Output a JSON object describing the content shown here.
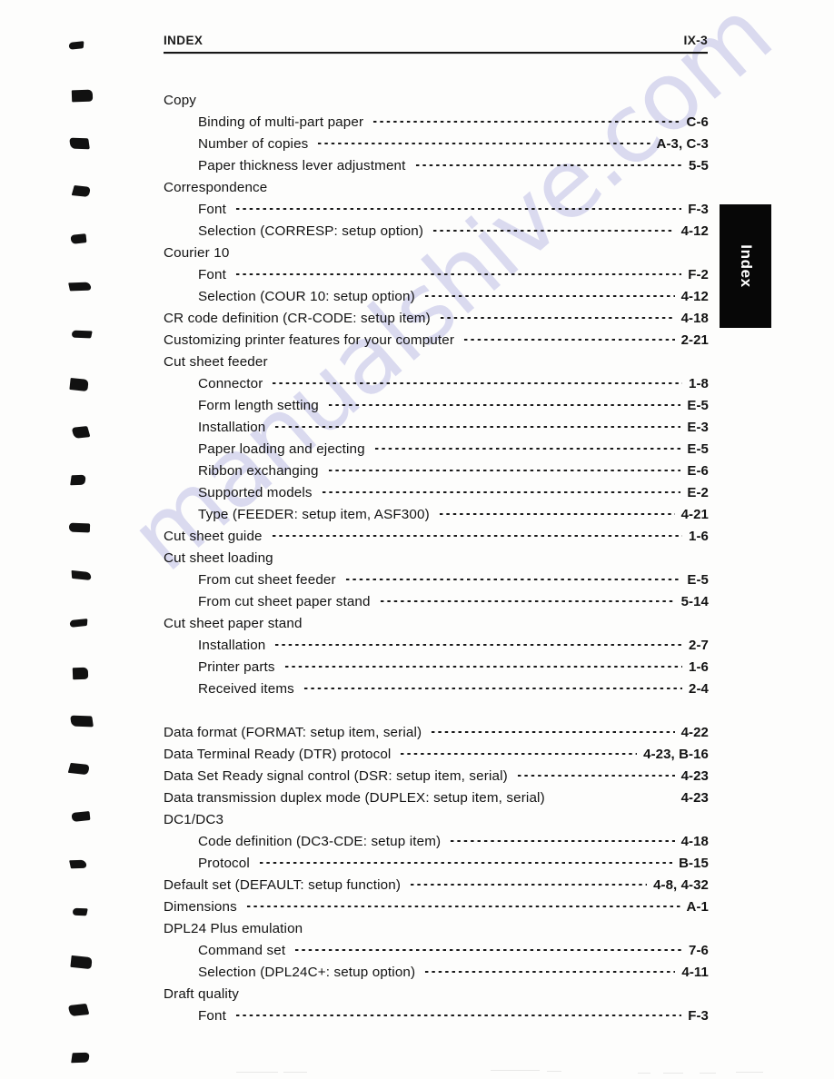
{
  "header": {
    "title": "INDEX",
    "page_number": "IX-3"
  },
  "thumb_tab": {
    "label": "Index"
  },
  "watermark": {
    "text": "manualshive.com"
  },
  "index": {
    "entries": [
      {
        "level": 0,
        "label": "Copy",
        "page": ""
      },
      {
        "level": 1,
        "label": "Binding of multi-part paper",
        "page": "C-6"
      },
      {
        "level": 1,
        "label": "Number of copies",
        "page": "A-3, C-3"
      },
      {
        "level": 1,
        "label": "Paper thickness lever adjustment",
        "page": "5-5"
      },
      {
        "level": 0,
        "label": "Correspondence",
        "page": ""
      },
      {
        "level": 1,
        "label": "Font",
        "page": "F-3"
      },
      {
        "level": 1,
        "label": "Selection (CORRESP: setup option)",
        "page": "4-12"
      },
      {
        "level": 0,
        "label": "Courier 10",
        "page": ""
      },
      {
        "level": 1,
        "label": "Font",
        "page": "F-2"
      },
      {
        "level": 1,
        "label": "Selection (COUR 10: setup option)",
        "page": "4-12"
      },
      {
        "level": 0,
        "label": "CR code definition (CR-CODE: setup item)",
        "page": "4-18"
      },
      {
        "level": 0,
        "label": "Customizing printer features for your computer",
        "page": "2-21"
      },
      {
        "level": 0,
        "label": "Cut sheet feeder",
        "page": ""
      },
      {
        "level": 1,
        "label": "Connector",
        "page": "1-8"
      },
      {
        "level": 1,
        "label": "Form length setting",
        "page": "E-5"
      },
      {
        "level": 1,
        "label": "Installation",
        "page": "E-3"
      },
      {
        "level": 1,
        "label": "Paper loading and ejecting",
        "page": "E-5"
      },
      {
        "level": 1,
        "label": "Ribbon exchanging",
        "page": "E-6"
      },
      {
        "level": 1,
        "label": "Supported models",
        "page": "E-2"
      },
      {
        "level": 1,
        "label": "Type (FEEDER: setup item, ASF300)",
        "page": "4-21"
      },
      {
        "level": 0,
        "label": "Cut sheet guide",
        "page": "1-6"
      },
      {
        "level": 0,
        "label": "Cut sheet loading",
        "page": ""
      },
      {
        "level": 1,
        "label": "From cut sheet feeder",
        "page": "E-5"
      },
      {
        "level": 1,
        "label": "From cut sheet paper stand",
        "page": "5-14"
      },
      {
        "level": 0,
        "label": "Cut sheet paper stand",
        "page": ""
      },
      {
        "level": 1,
        "label": "Installation",
        "page": "2-7"
      },
      {
        "level": 1,
        "label": "Printer parts",
        "page": "1-6"
      },
      {
        "level": 1,
        "label": "Received items",
        "page": "2-4"
      },
      {
        "level": -1,
        "label": "",
        "page": ""
      },
      {
        "level": 0,
        "label": "Data format (FORMAT: setup item, serial)",
        "page": "4-22"
      },
      {
        "level": 0,
        "label": "Data Terminal Ready (DTR) protocol",
        "page": "4-23, B-16"
      },
      {
        "level": 0,
        "label": "Data Set Ready signal control (DSR: setup item, serial)",
        "page": "4-23"
      },
      {
        "level": 0,
        "label": "Data transmission duplex mode (DUPLEX: setup item, serial)",
        "page": "4-23",
        "noleader": true
      },
      {
        "level": 0,
        "label": "DC1/DC3",
        "page": ""
      },
      {
        "level": 1,
        "label": "Code definition (DC3-CDE: setup item)",
        "page": "4-18"
      },
      {
        "level": 1,
        "label": "Protocol",
        "page": "B-15"
      },
      {
        "level": 0,
        "label": "Default set (DEFAULT: setup function)",
        "page": "4-8, 4-32"
      },
      {
        "level": 0,
        "label": "Dimensions",
        "page": "A-1"
      },
      {
        "level": 0,
        "label": "DPL24 Plus emulation",
        "page": ""
      },
      {
        "level": 1,
        "label": "Command set",
        "page": "7-6"
      },
      {
        "level": 1,
        "label": "Selection (DPL24C+: setup option)",
        "page": "4-11"
      },
      {
        "level": 0,
        "label": "Draft quality",
        "page": ""
      },
      {
        "level": 1,
        "label": "Font",
        "page": "F-3"
      }
    ]
  },
  "colors": {
    "ink": "#121212",
    "tab_background": "#070707",
    "tab_text": "#ffffff",
    "watermark": "#d9d9ef",
    "paper": "#fdfdfc"
  }
}
